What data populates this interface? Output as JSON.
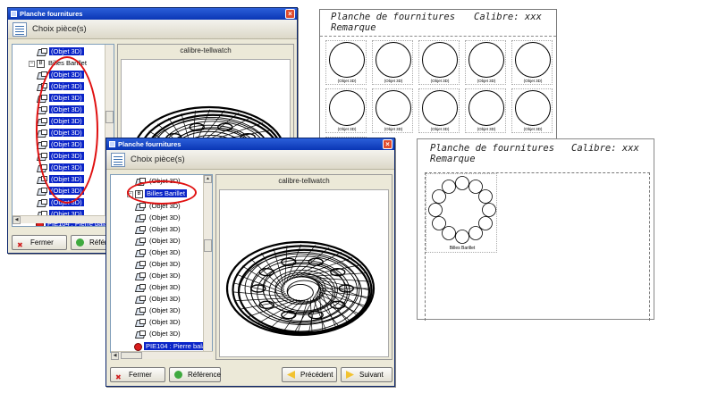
{
  "dialog_back": {
    "title": "Planche fournitures",
    "toolbar_label": "Choix pièce(s)",
    "preview_title": "calibre-tellwatch",
    "tree": {
      "first_item": "(Objet 3D)",
      "parent": "Billes Barillet",
      "children": [
        "(Objet 3D)",
        "(Objet 3D)",
        "(Objet 3D)",
        "(Objet 3D)",
        "(Objet 3D)",
        "(Objet 3D)",
        "(Objet 3D)",
        "(Objet 3D)",
        "(Objet 3D)",
        "(Objet 3D)",
        "(Objet 3D)",
        "(Objet 3D)",
        "(Objet 3D)"
      ],
      "last_item": "PIE104 : Pierre bala"
    },
    "buttons": {
      "close": "Fermer",
      "reference": "Référen"
    }
  },
  "dialog_front": {
    "title": "Planche fournitures",
    "toolbar_label": "Choix pièce(s)",
    "preview_title": "calibre-tellwatch",
    "tree": {
      "first_item": "(Objet 3D)",
      "parent": "Billes Barillet",
      "children": [
        "(Objet 3D)",
        "(Objet 3D)",
        "(Objet 3D)",
        "(Objet 3D)",
        "(Objet 3D)",
        "(Objet 3D)",
        "(Objet 3D)",
        "(Objet 3D)",
        "(Objet 3D)",
        "(Objet 3D)",
        "(Objet 3D)",
        "(Objet 3D)"
      ],
      "last_item": "PIE104 : Pierre bala"
    },
    "buttons": {
      "close": "Fermer",
      "reference": "Référence",
      "previous": "Précédent",
      "next": "Suivant"
    }
  },
  "sheet_top": {
    "title": "Planche de fournitures",
    "calibre": "Calibre:  xxx",
    "remark": "Remarque",
    "cell_label": "(Objet 3D)"
  },
  "sheet_bottom": {
    "title": "Planche de fournitures",
    "calibre": "Calibre:  xxx",
    "remark": "Remarque",
    "group_label": "Billes Barillet"
  },
  "colors": {
    "selection": "#0a24c8",
    "highlight_ring": "#e01010",
    "titlebar": "#0a36b5"
  }
}
